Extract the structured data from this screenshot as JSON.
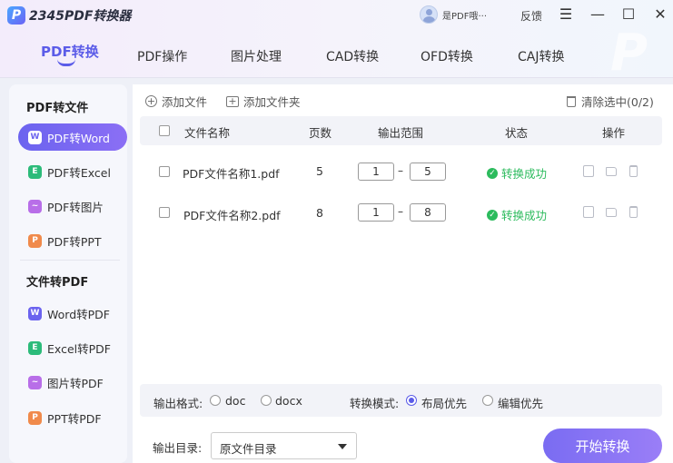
{
  "app": {
    "logo_mark": "P",
    "title": "2345PDF转换器",
    "user_name": "是PDF哦···",
    "feedback": "反馈"
  },
  "window_controls": {
    "menu": "☰",
    "minimize": "—",
    "maximize": "☐",
    "close": "✕"
  },
  "nav": {
    "tabs": [
      "PDF转换",
      "PDF操作",
      "图片处理",
      "CAD转换",
      "OFD转换",
      "CAJ转换"
    ],
    "active_index": 0
  },
  "sidebar": {
    "group1_title": "PDF转文件",
    "group1_items": [
      {
        "label": "PDF转Word",
        "icon": "W",
        "color": "#5b7cf5"
      },
      {
        "label": "PDF转Excel",
        "icon": "E",
        "color": "#2cbb7a"
      },
      {
        "label": "PDF转图片",
        "icon": "~",
        "color": "#b86ee8"
      },
      {
        "label": "PDF转PPT",
        "icon": "P",
        "color": "#f08a4b"
      }
    ],
    "group2_title": "文件转PDF",
    "group2_items": [
      {
        "label": "Word转PDF",
        "icon": "W",
        "color": "#6b63ef"
      },
      {
        "label": "Excel转PDF",
        "icon": "E",
        "color": "#2cbb7a"
      },
      {
        "label": "图片转PDF",
        "icon": "~",
        "color": "#b86ee8"
      },
      {
        "label": "PPT转PDF",
        "icon": "P",
        "color": "#f08a4b"
      }
    ],
    "active": "PDF转Word"
  },
  "toolbar": {
    "add_file": "添加文件",
    "add_folder": "添加文件夹",
    "clear_selected": "清除选中(0/2)"
  },
  "table": {
    "headers": {
      "name": "文件名称",
      "pages": "页数",
      "range": "输出范围",
      "status": "状态",
      "action": "操作"
    },
    "rows": [
      {
        "name": "PDF文件名称1.pdf",
        "pages": "5",
        "range_from": "1",
        "range_sep": "–",
        "range_to": "5",
        "status": "转换成功"
      },
      {
        "name": "PDF文件名称2.pdf",
        "pages": "8",
        "range_from": "1",
        "range_sep": "–",
        "range_to": "8",
        "status": "转换成功"
      }
    ]
  },
  "settings": {
    "format_label": "输出格式:",
    "format_options": [
      "doc",
      "docx"
    ],
    "mode_label": "转换模式:",
    "mode_options": [
      "布局优先",
      "编辑优先"
    ],
    "mode_selected": "布局优先"
  },
  "output": {
    "dir_label": "输出目录:",
    "dir_value": "原文件目录"
  },
  "start_button": "开始转换",
  "colors": {
    "accent": "#5b5ce8",
    "success": "#2cbb5d"
  }
}
